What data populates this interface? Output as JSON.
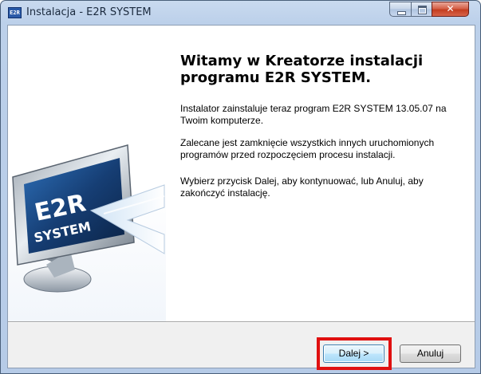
{
  "window": {
    "title": "Instalacja - E2R SYSTEM",
    "icon": "installer-icon",
    "controls": {
      "minimize_icon": "minimize-icon",
      "maximize_icon": "maximize-icon",
      "close_icon": "close-icon"
    }
  },
  "wizard": {
    "heading": "Witamy w Kreatorze instalacji programu E2R SYSTEM.",
    "paragraphs": [
      "Instalator zainstaluje teraz program E2R SYSTEM 13.05.07 na Twoim komputerze.",
      "Zalecane jest zamknięcie wszystkich innych uruchomionych programów przed rozpoczęciem procesu instalacji.",
      "Wybierz przycisk Dalej, aby kontynuować, lub Anuluj, aby zakończyć instalację."
    ],
    "artwork": {
      "line1": "E2R",
      "line2": "SYSTEM",
      "icon": "monitor-logo-icon"
    }
  },
  "buttons": {
    "next_label": "Dalej >",
    "cancel_label": "Anuluj"
  },
  "colors": {
    "highlight": "#e01010",
    "accent": "#3c7fb1"
  }
}
